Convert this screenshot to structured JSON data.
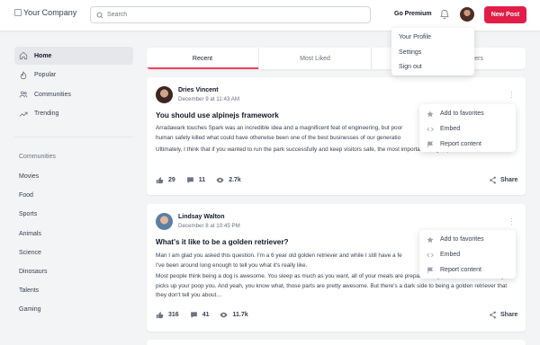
{
  "header": {
    "logo_alt": "Your Company",
    "search_placeholder": "Search",
    "go_premium": "Go Premium",
    "new_post": "New Post"
  },
  "profile_menu": [
    "Your Profile",
    "Settings",
    "Sign out"
  ],
  "sidebar": {
    "nav": [
      {
        "label": "Home",
        "icon": "home-icon",
        "active": true
      },
      {
        "label": "Popular",
        "icon": "flame-icon",
        "active": false
      },
      {
        "label": "Communities",
        "icon": "users-icon",
        "active": false
      },
      {
        "label": "Trending",
        "icon": "trending-icon",
        "active": false
      }
    ],
    "communities_heading": "Communities",
    "communities": [
      "Movies",
      "Food",
      "Sports",
      "Animals",
      "Science",
      "Dinosaurs",
      "Talents",
      "Gaming"
    ]
  },
  "tabs": [
    {
      "label": "Recent",
      "active": true
    },
    {
      "label": "Most Liked",
      "active": false
    },
    {
      "label": "ers",
      "active": false
    }
  ],
  "posts": [
    {
      "author": "Dries Vincent",
      "date": "December 9 at 11:43 AM",
      "title": "You should use alpinejs framework",
      "body1": "Arradawark touches Spark was an incredible idea and a magnificent feat of engineering, but poor",
      "body1b": "human safety killed what could have otherwise been one of the best businesses of our generatio",
      "body2": "Ultimately, I think that if you wanted to run the park successfully and keep visitors safe, the most important thing to prioritize would be…",
      "likes": "29",
      "replies": "11",
      "views": "2.7k",
      "share": "Share"
    },
    {
      "author": "Lindsay Walton",
      "date": "December 8 at 10:45 PM",
      "title": "What's it like to be a golden retriever?",
      "body1": "Man I am glad you asked this question. I'm a 6 year old golden retriever and while I still have a fe",
      "body1b": "I've been around long enough to tell you what it's really like.",
      "body2": "Most people think being a dog is awesome. You sleep as much as you want, all of your meals are prepared for you, and someone literally picks up your poop you. And yeah, you know what, those parts are pretty awesome. But there's a dark side to being a golden retriever that they don't tell you about…",
      "likes": "316",
      "replies": "41",
      "views": "11.7k",
      "share": "Share"
    }
  ],
  "post_menu": [
    "Add to favorites",
    "Embed",
    "Report content"
  ],
  "colors": {
    "accent": "#e11d48",
    "tab_underline": "#f43f5e"
  }
}
